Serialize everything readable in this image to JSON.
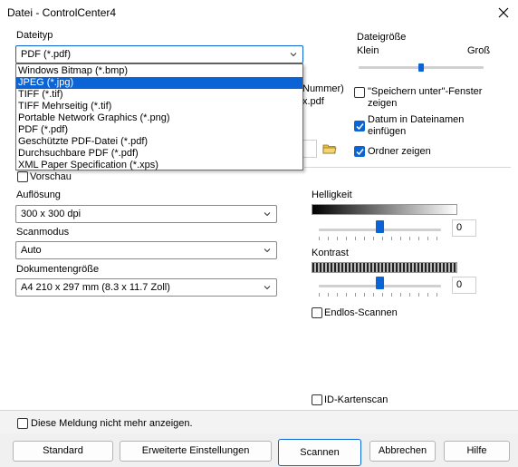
{
  "window": {
    "title": "Datei - ControlCenter4",
    "close_label": "✕"
  },
  "file_type": {
    "label": "Dateityp",
    "selected": "PDF (*.pdf)",
    "options": [
      "Windows Bitmap (*.bmp)",
      "JPEG (*.jpg)",
      "TIFF (*.tif)",
      "TIFF Mehrseitig (*.tif)",
      "Portable Network Graphics (*.png)",
      "PDF (*.pdf)",
      "Geschützte PDF-Datei  (*.pdf)",
      "Durchsuchbare PDF (*.pdf)",
      "XML Paper Specification (*.xps)"
    ],
    "highlighted_index": 1
  },
  "file_size": {
    "label": "Dateigröße",
    "min_label": "Klein",
    "max_label": "Groß",
    "level": 0.5
  },
  "partial_texts": {
    "nummer": "Nummer)",
    "ext": "x.pdf"
  },
  "options": {
    "save_as_window": {
      "label": "\"Speichern unter\"-Fenster zeigen",
      "line1": "\"Speichern unter\"-Fenster",
      "line2": "zeigen",
      "checked": false
    },
    "date_in_filename": {
      "line1": "Datum in Dateinamen",
      "line2": "einfügen",
      "checked": true
    },
    "show_folder": {
      "label": "Ordner zeigen",
      "checked": true
    }
  },
  "preview": {
    "label": "Vorschau",
    "checked": false
  },
  "resolution": {
    "label": "Auflösung",
    "value": "300 x 300 dpi"
  },
  "scan_mode": {
    "label": "Scanmodus",
    "value": "Auto"
  },
  "document_size": {
    "label": "Dokumentengröße",
    "value": "A4 210 x 297 mm (8.3 x 11.7 Zoll)"
  },
  "brightness": {
    "label": "Helligkeit",
    "value": "0",
    "level": 0.5
  },
  "contrast": {
    "label": "Kontrast",
    "value": "0",
    "level": 0.5
  },
  "continuous_scan": {
    "label": "Endlos-Scannen",
    "checked": false
  },
  "id_card_scan": {
    "label": "ID-Kartenscan",
    "checked": false
  },
  "dont_show": {
    "label": "Diese Meldung nicht mehr anzeigen.",
    "checked": false
  },
  "buttons": {
    "standard": "Standard",
    "advanced": "Erweiterte Einstellungen",
    "scan": "Scannen",
    "cancel": "Abbrechen",
    "help": "Hilfe"
  },
  "colors": {
    "accent": "#0a64d6",
    "background": "#ffffff"
  },
  "icons": {
    "folder": "folder-icon",
    "chevron": "chevron-down-icon",
    "check": "check-icon"
  }
}
